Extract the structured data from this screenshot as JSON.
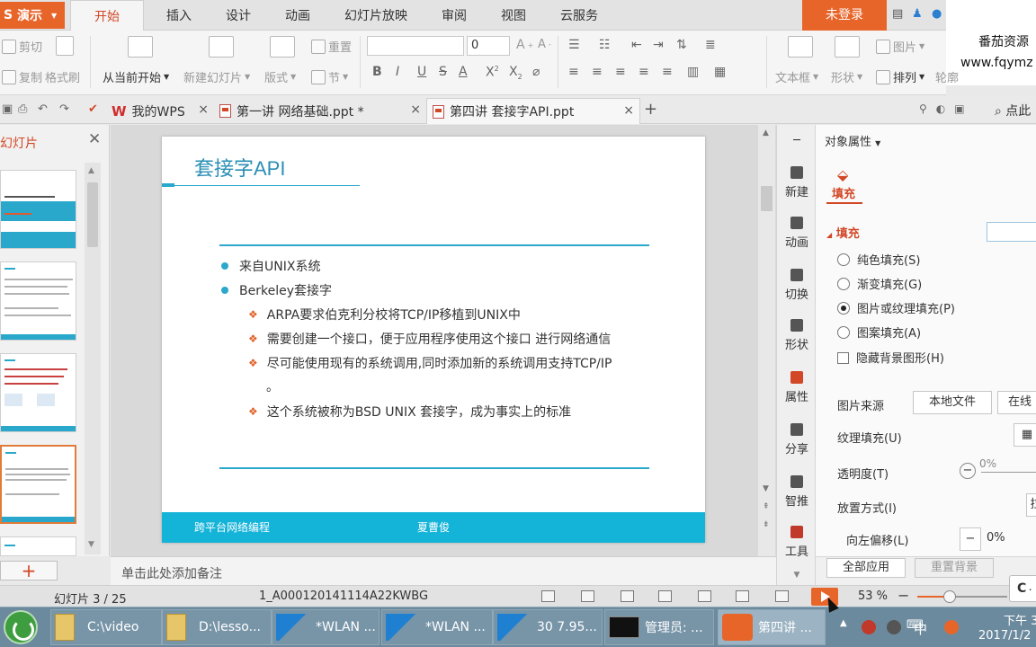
{
  "app": {
    "name": "演示",
    "logo": "S",
    "login": "未登录"
  },
  "menu_tabs": [
    "开始",
    "插入",
    "设计",
    "动画",
    "幻灯片放映",
    "审阅",
    "视图",
    "云服务"
  ],
  "watermark": {
    "line1": "番茄资源",
    "line2": "www.fqymz"
  },
  "ribbon": {
    "cut": "剪切",
    "copy": "复制",
    "format_painter": "格式刷",
    "from_current": "从当前开始",
    "new_slide": "新建幻灯片",
    "layout": "版式",
    "reset": "重置",
    "section": "节",
    "font_size": "0",
    "textbox": "文本框",
    "shape": "形状",
    "picture": "图片",
    "arrange": "排列",
    "outline": "轮廓"
  },
  "doc_tabs": [
    {
      "label": "我的WPS"
    },
    {
      "label": "第一讲 网络基础.ppt *"
    },
    {
      "label": "第四讲 套接字API.ppt"
    }
  ],
  "search": {
    "label": "点此"
  },
  "thumbs": {
    "title": "幻灯片"
  },
  "slide": {
    "title": "套接字API",
    "bullets": [
      "来自UNIX系统",
      "Berkeley套接字"
    ],
    "subbullets": [
      "ARPA要求伯克利分校将TCP/IP移植到UNIX中",
      "需要创建一个接口，便于应用程序使用这个接口  进行网络通信",
      "尽可能使用现有的系统调用,同时添加新的系统调用支持TCP/IP",
      "这个系统被称为BSD UNIX 套接字，成为事实上的标准"
    ],
    "wrap_tail": "。",
    "footer_left": "跨平台网络编程",
    "footer_mid": "夏曹俊"
  },
  "notes": {
    "placeholder": "单击此处添加备注"
  },
  "side_tools": [
    "新建",
    "动画",
    "切换",
    "形状",
    "属性",
    "分享",
    "智推",
    "工具"
  ],
  "props": {
    "header": "对象属性",
    "tab": "填充",
    "section": "填充",
    "options": [
      "纯色填充(S)",
      "渐变填充(G)",
      "图片或纹理填充(P)",
      "图案填充(A)"
    ],
    "selected_index": 2,
    "hide_bg": "隐藏背景图形(H)",
    "source_label": "图片来源",
    "local_file": "本地文件",
    "online": "在线",
    "texture": "纹理填充(U)",
    "transparency": "透明度(T)",
    "transparency_value": "0%",
    "placement": "放置方式(I)",
    "placement_value": "拉",
    "offset": "向左偏移(L)",
    "offset_value": "0%",
    "apply_all": "全部应用",
    "reset_bg": "重置背景"
  },
  "status": {
    "slide": "幻灯片 3 / 25",
    "file": "1_A000120141114A22KWBG",
    "zoom": "53 %",
    "zoom_level": 0.36
  },
  "c_button": "C",
  "taskbar": {
    "items": [
      "C:\\video",
      "D:\\lesso...",
      "*WLAN ...",
      "*WLAN ...",
      "30 7.95...",
      "管理员: ...",
      "第四讲 ..."
    ],
    "ime": "中",
    "time": "下午 3",
    "date": "2017/1/2"
  }
}
